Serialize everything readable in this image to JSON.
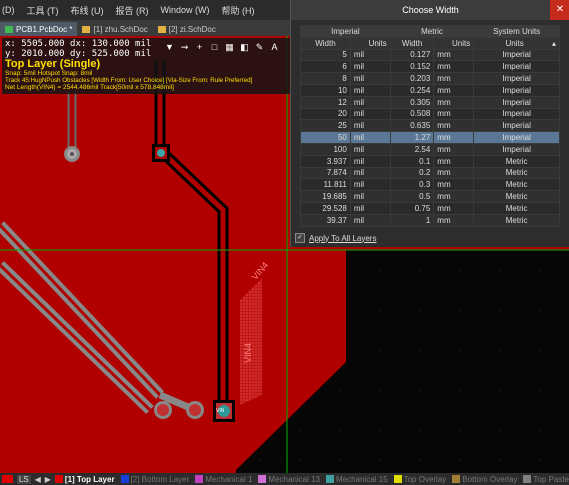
{
  "menu": {
    "items": [
      "(D)",
      "工具 (T)",
      "布线 (U)",
      "报告 (R)",
      "Window (W)",
      "帮助 (H)"
    ]
  },
  "tabs": [
    {
      "label": "PCB1.PcbDoc *",
      "color": "#3fb950",
      "active": true
    },
    {
      "label": "[1] zhu.SchDoc",
      "color": "#e3b341",
      "active": false
    },
    {
      "label": "[2] zi.SchDoc",
      "color": "#e3b341",
      "active": false
    }
  ],
  "hud": {
    "line1": "x:  5505.000  dx:   130.000 mil",
    "line2": "y:  2010.000  dy:   525.000 mil",
    "layer": "Top Layer (Single)",
    "snap": "Snap: 5mil Hotspot Snap: 8mil",
    "track": "Track 45:HugNPush Obstacles [Width From: User Choice] [Via-Size From: Rule Preferred]",
    "net": "Net Length(VIN4) = 2544.486mil Track[50mil x 578.848mil]"
  },
  "board": {
    "net_label_1": "VIN4",
    "net_label_2": "VIN4",
    "pad_label": "VIN"
  },
  "dialog": {
    "title": "Choose Width",
    "group_headers": [
      "Imperial",
      "Metric",
      "System Units"
    ],
    "sub_headers": [
      "Width",
      "Units",
      "Width",
      "Units",
      "Units"
    ],
    "rows": [
      {
        "iw": "5",
        "iu": "mil",
        "mw": "0.127",
        "mu": "mm",
        "su": "Imperial",
        "sel": false
      },
      {
        "iw": "6",
        "iu": "mil",
        "mw": "0.152",
        "mu": "mm",
        "su": "Imperial",
        "sel": false
      },
      {
        "iw": "8",
        "iu": "mil",
        "mw": "0.203",
        "mu": "mm",
        "su": "Imperial",
        "sel": false
      },
      {
        "iw": "10",
        "iu": "mil",
        "mw": "0.254",
        "mu": "mm",
        "su": "Imperial",
        "sel": false
      },
      {
        "iw": "12",
        "iu": "mil",
        "mw": "0.305",
        "mu": "mm",
        "su": "Imperial",
        "sel": false
      },
      {
        "iw": "20",
        "iu": "mil",
        "mw": "0.508",
        "mu": "mm",
        "su": "Imperial",
        "sel": false
      },
      {
        "iw": "25",
        "iu": "mil",
        "mw": "0.635",
        "mu": "mm",
        "su": "Imperial",
        "sel": false
      },
      {
        "iw": "50",
        "iu": "mil",
        "mw": "1.27",
        "mu": "mm",
        "su": "Imperial",
        "sel": true
      },
      {
        "iw": "100",
        "iu": "mil",
        "mw": "2.54",
        "mu": "mm",
        "su": "Imperial",
        "sel": false
      },
      {
        "iw": "3.937",
        "iu": "mil",
        "mw": "0.1",
        "mu": "mm",
        "su": "Metric",
        "sel": false
      },
      {
        "iw": "7.874",
        "iu": "mil",
        "mw": "0.2",
        "mu": "mm",
        "su": "Metric",
        "sel": false
      },
      {
        "iw": "11.811",
        "iu": "mil",
        "mw": "0.3",
        "mu": "mm",
        "su": "Metric",
        "sel": false
      },
      {
        "iw": "19.685",
        "iu": "mil",
        "mw": "0.5",
        "mu": "mm",
        "su": "Metric",
        "sel": false
      },
      {
        "iw": "29.528",
        "iu": "mil",
        "mw": "0.75",
        "mu": "mm",
        "su": "Metric",
        "sel": false
      },
      {
        "iw": "39.37",
        "iu": "mil",
        "mw": "1",
        "mu": "mm",
        "su": "Metric",
        "sel": false
      }
    ],
    "apply_label": "Apply To All Layers",
    "apply_checked": true
  },
  "statusbar": {
    "ls_label": "LS",
    "layers": [
      {
        "label": "[1] Top Layer",
        "color": "#e00000",
        "active": true
      },
      {
        "label": "[2] Bottom Layer",
        "color": "#1a3fd8",
        "active": false
      },
      {
        "label": "Mechanical 1",
        "color": "#c040c0",
        "active": false
      },
      {
        "label": "Mechanical 13",
        "color": "#d070d0",
        "active": false
      },
      {
        "label": "Mechanical 15",
        "color": "#40a0a0",
        "active": false
      },
      {
        "label": "Top Overlay",
        "color": "#e0e000",
        "active": false
      },
      {
        "label": "Bottom Overlay",
        "color": "#a08030",
        "active": false
      },
      {
        "label": "Top Paste",
        "color": "#808080",
        "active": false
      }
    ]
  },
  "colors": {
    "copper": "#b00000",
    "selected_row": "#5a7896",
    "cursor_line": "#00b000"
  }
}
